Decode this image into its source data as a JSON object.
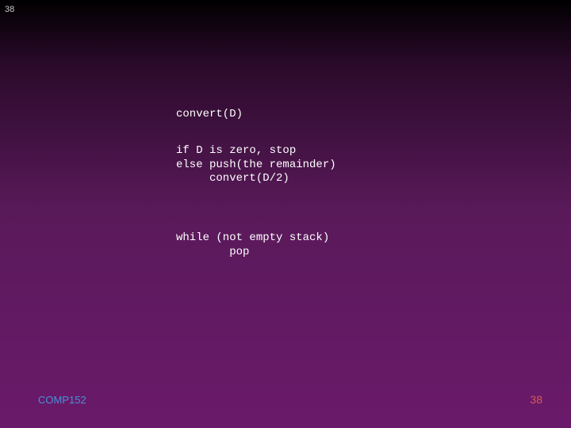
{
  "top_number": "38",
  "code": {
    "line1": "convert(D)",
    "line2": "if D is zero, stop",
    "line3": "else push(the remainder)",
    "line4": "     convert(D/2)",
    "line5": "while (not empty stack)",
    "line6": "        pop"
  },
  "footer": {
    "left": "COMP152",
    "right": "38"
  }
}
